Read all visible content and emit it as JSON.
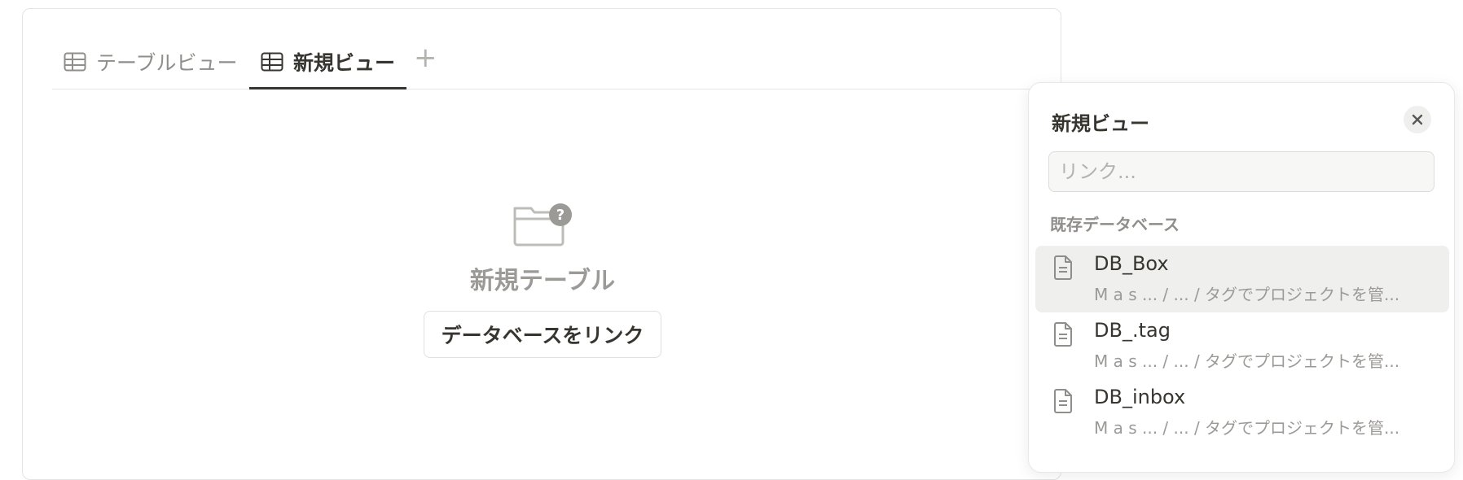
{
  "tabs": [
    {
      "label": "テーブルビュー",
      "icon": "table-icon",
      "active": false
    },
    {
      "label": "新規ビュー",
      "icon": "table-icon",
      "active": true
    }
  ],
  "add_tab": {
    "label": "+"
  },
  "empty_state": {
    "icon": "folder-question-icon",
    "title": "新規テーブル",
    "button_label": "データベースをリンク"
  },
  "panel": {
    "title": "新規ビュー",
    "close_icon": "close-icon",
    "search": {
      "value": "",
      "placeholder": "リンク..."
    },
    "section_label": "既存データベース",
    "items": [
      {
        "name": "DB_Box",
        "path": "M a s ... / ... / タグでプロジェクトを管...",
        "icon": "page-icon"
      },
      {
        "name": "DB_.tag",
        "path": "M a s ... / ... / タグでプロジェクトを管...",
        "icon": "page-icon"
      },
      {
        "name": "DB_inbox",
        "path": "M a s ... / ... / タグでプロジェクトを管...",
        "icon": "page-icon"
      }
    ]
  },
  "colors": {
    "text": "#37352f",
    "muted": "#9b9a97",
    "hover": "#efefed",
    "border": "#e4e4e2"
  }
}
